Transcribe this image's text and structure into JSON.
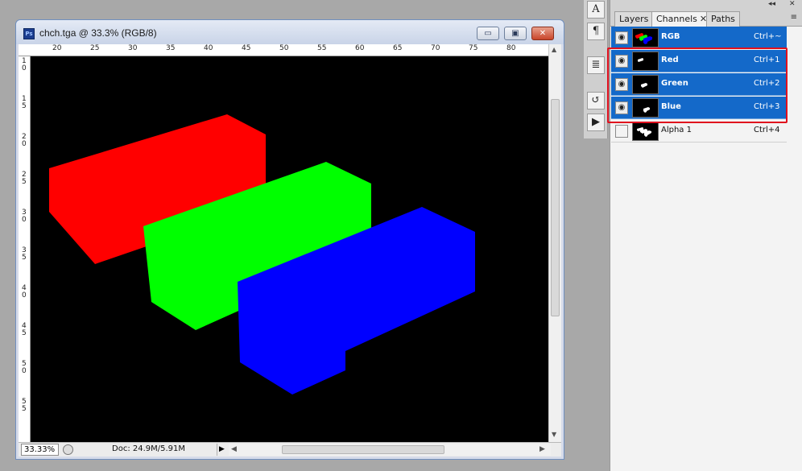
{
  "document": {
    "title": "chch.tga @ 33.3% (RGB/8)",
    "app_icon_text": "Ps",
    "minimize_glyph": "▭",
    "maximize_glyph": "▣",
    "close_glyph": "✕"
  },
  "ruler": {
    "top_labels": [
      "20",
      "25",
      "30",
      "35",
      "40",
      "45",
      "50",
      "55",
      "60",
      "65",
      "70",
      "75",
      "80"
    ],
    "left_labels": [
      "1 0",
      "1 5",
      "2 0",
      "2 5",
      "3 0",
      "3 5",
      "4 0",
      "4 5",
      "5 0",
      "5 5"
    ]
  },
  "canvas": {
    "background": "#000000",
    "shapes": [
      {
        "name": "red-box",
        "color": "#ff0000"
      },
      {
        "name": "green-box",
        "color": "#00ff00"
      },
      {
        "name": "blue-box",
        "color": "#0000ff"
      }
    ]
  },
  "status": {
    "zoom": "33.33%",
    "doc_size": "Doc: 24.9M/5.91M",
    "arrow_glyph": "▶",
    "left_arrow": "◀",
    "right_arrow": "▶"
  },
  "toolstrip": {
    "items": [
      "A",
      "¶",
      "≣",
      "↺",
      "▶"
    ]
  },
  "panel": {
    "tabs": [
      {
        "label": "Layers"
      },
      {
        "label": "Channels",
        "active": true,
        "close": "✕"
      },
      {
        "label": "Paths"
      }
    ],
    "menu_glyph": "≡",
    "collapse_glyph": "◂◂",
    "close_glyph": "✕",
    "eye_glyph": "◉",
    "channels": [
      {
        "name": "RGB",
        "shortcut": "Ctrl+~",
        "selected": true,
        "visible": true
      },
      {
        "name": "Red",
        "shortcut": "Ctrl+1",
        "selected": true,
        "visible": true
      },
      {
        "name": "Green",
        "shortcut": "Ctrl+2",
        "selected": true,
        "visible": true
      },
      {
        "name": "Blue",
        "shortcut": "Ctrl+3",
        "selected": true,
        "visible": true
      },
      {
        "name": "Alpha 1",
        "shortcut": "Ctrl+4",
        "selected": false,
        "visible": false
      }
    ]
  },
  "colors": {
    "selection": "#1469c9",
    "highlight_border": "#e0101e"
  }
}
